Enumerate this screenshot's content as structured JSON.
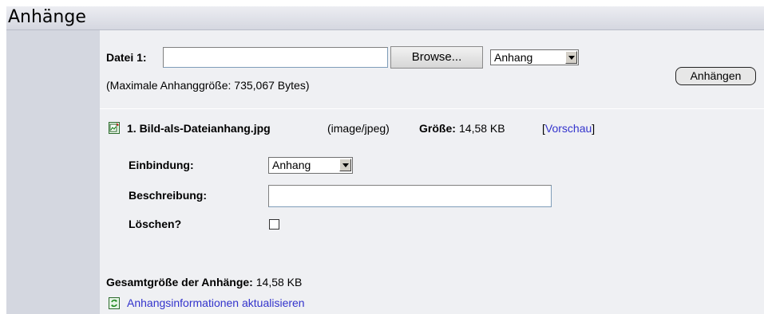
{
  "section_title": "Anhänge",
  "upload": {
    "file_label": "Datei 1:",
    "browse_label": "Browse...",
    "type_select_value": "Anhang",
    "attach_button_label": "Anhängen",
    "max_size_note": "(Maximale Anhanggröße: 735,067 Bytes)"
  },
  "attachment": {
    "filename": "1. Bild-als-Dateianhang.jpg",
    "mimetype": "(image/jpeg)",
    "size_label": "Größe:",
    "size_value": "14,58 KB",
    "preview_link_open": "[",
    "preview_link": "Vorschau",
    "preview_link_close": "]",
    "embedding_label": "Einbindung:",
    "embedding_value": "Anhang",
    "description_label": "Beschreibung:",
    "description_value": "",
    "delete_label": "Löschen?",
    "delete_checked": false
  },
  "totals": {
    "label": "Gesamtgröße der Anhänge:",
    "value": "14,58 KB"
  },
  "refresh_link": "Anhangsinformationen aktualisieren"
}
